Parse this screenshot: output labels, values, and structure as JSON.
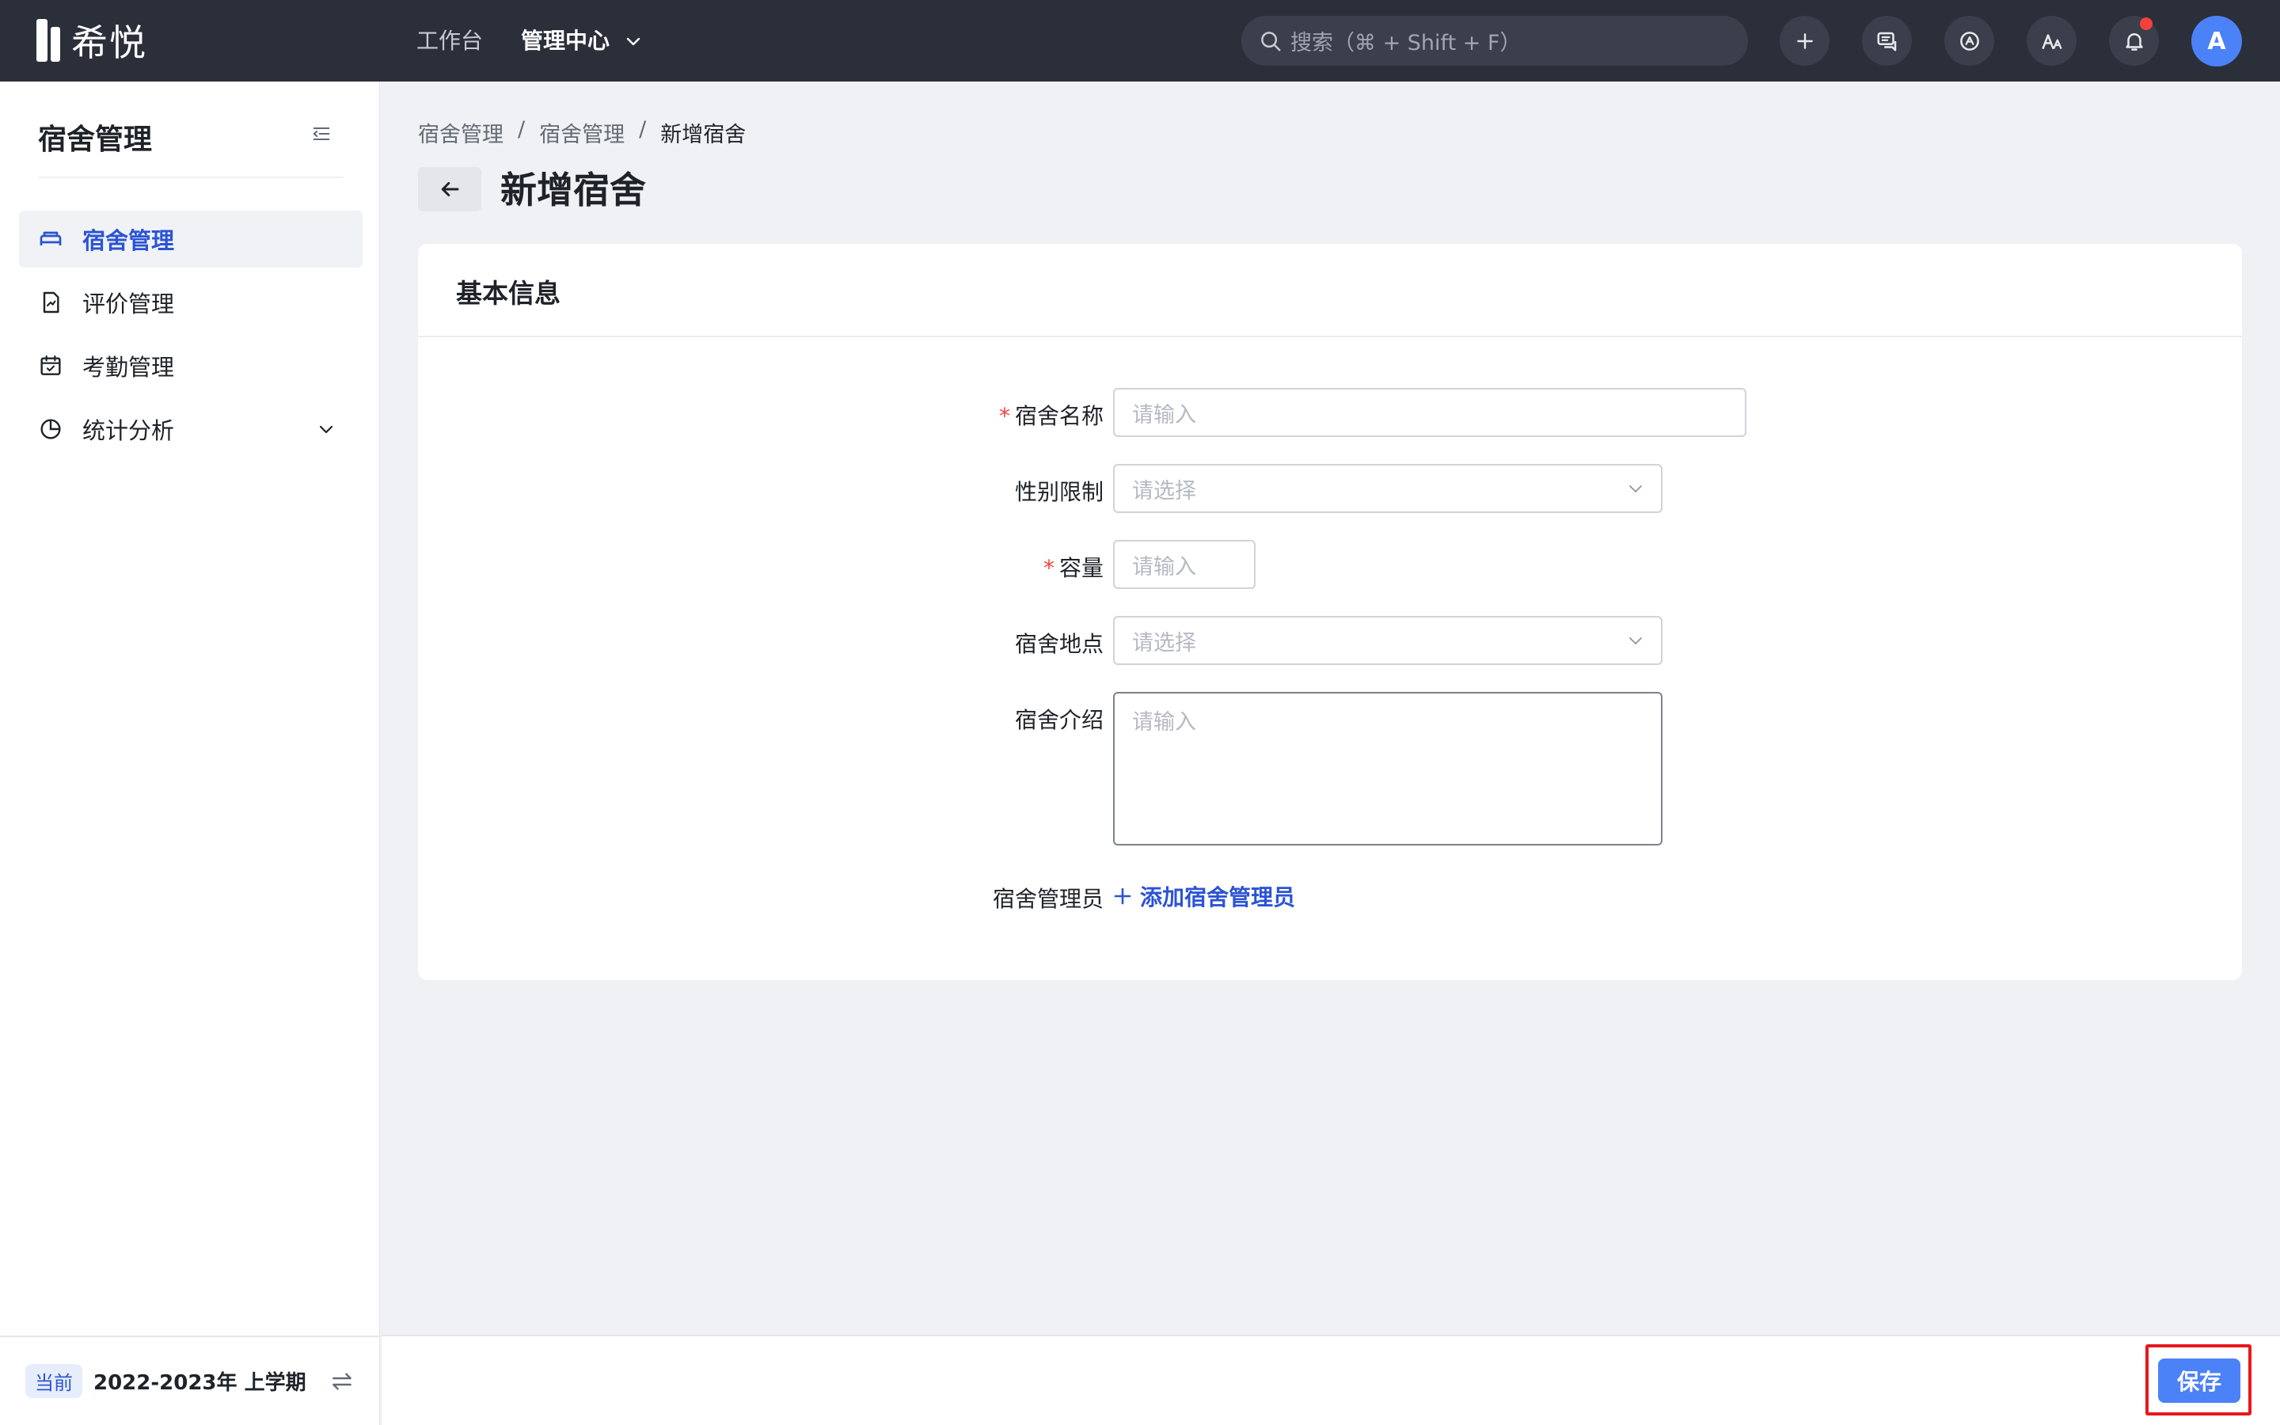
{
  "app": {
    "logo_text": "希悦"
  },
  "topnav": {
    "workbench": "工作台",
    "admin_center": "管理中心",
    "search_placeholder": "搜索（⌘ + Shift + F）",
    "avatar_initial": "A"
  },
  "sidebar": {
    "title": "宿舍管理",
    "items": [
      {
        "label": "宿舍管理",
        "icon": "bed-icon",
        "active": true
      },
      {
        "label": "评价管理",
        "icon": "evaluation-icon",
        "active": false
      },
      {
        "label": "考勤管理",
        "icon": "calendar-icon",
        "active": false
      },
      {
        "label": "统计分析",
        "icon": "pie-chart-icon",
        "active": false
      }
    ],
    "term": {
      "badge": "当前",
      "label": "2022-2023年 上学期"
    }
  },
  "breadcrumb": [
    "宿舍管理",
    "宿舍管理",
    "新增宿舍"
  ],
  "breadcrumb_sep": "/",
  "page": {
    "title": "新增宿舍"
  },
  "form": {
    "section_title": "基本信息",
    "required_mark": "*",
    "fields": {
      "name": {
        "label": "宿舍名称",
        "placeholder": "请输入"
      },
      "gender": {
        "label": "性别限制",
        "placeholder": "请选择"
      },
      "capacity": {
        "label": "容量",
        "placeholder": "请输入"
      },
      "location": {
        "label": "宿舍地点",
        "placeholder": "请选择"
      },
      "intro": {
        "label": "宿舍介绍",
        "placeholder": "请输入"
      },
      "admin": {
        "label": "宿舍管理员",
        "add_label": "添加宿舍管理员"
      }
    }
  },
  "footer": {
    "save_label": "保存"
  },
  "colors": {
    "accent": "#4c82f7",
    "link": "#2b53d4",
    "required": "#f5413d",
    "topbar": "#2b2f3a",
    "highlight": "#e8181c"
  }
}
